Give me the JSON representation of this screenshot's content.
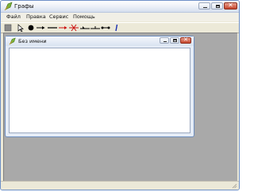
{
  "main_window": {
    "title": "Графы",
    "controls": {
      "minimize_icon": "minimize-icon",
      "maximize_icon": "maximize-icon",
      "close_icon": "close-icon"
    }
  },
  "menu": {
    "items": [
      {
        "label": "Файл"
      },
      {
        "label": "Правка"
      },
      {
        "label": "Сервис"
      },
      {
        "label": "Помощь"
      }
    ]
  },
  "toolbar": {
    "tools": [
      {
        "icon": "square-tool-icon"
      },
      {
        "icon": "pointer-tool-icon"
      },
      {
        "icon": "vertex-tool-icon"
      },
      {
        "icon": "directed-edge-tool-icon"
      },
      {
        "icon": "edge-tool-icon"
      },
      {
        "icon": "arc-tool-icon"
      },
      {
        "icon": "delete-edge-tool-icon"
      },
      {
        "icon": "edge-arrow-tool-icon"
      },
      {
        "icon": "edge-split-tool-icon"
      },
      {
        "icon": "edge-endpoints-tool-icon"
      },
      {
        "icon": "info-tool-icon"
      }
    ]
  },
  "child_window": {
    "title": "Без имени"
  },
  "colors": {
    "accent_close": "#c5452c",
    "mdi_background": "#a9a9a9",
    "edge_red": "#cc1111"
  }
}
